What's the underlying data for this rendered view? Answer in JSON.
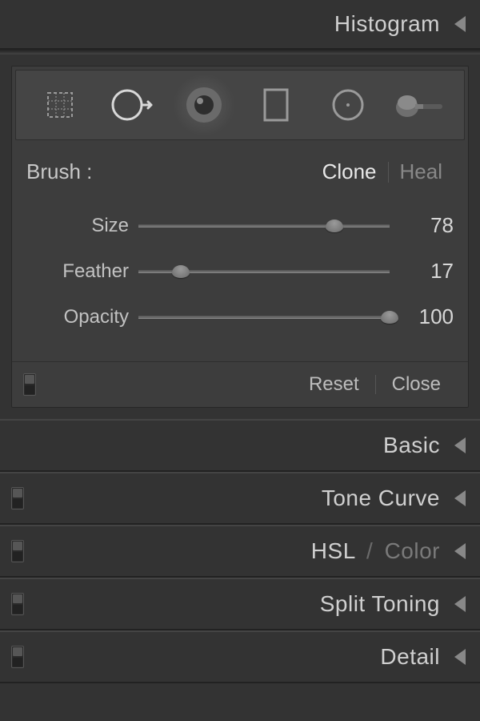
{
  "histogram": {
    "title": "Histogram"
  },
  "tools": [
    {
      "name": "crop-tool"
    },
    {
      "name": "spot-removal-tool",
      "selected": false
    },
    {
      "name": "redeye-tool",
      "selected": true
    },
    {
      "name": "graduated-filter-tool"
    },
    {
      "name": "radial-filter-tool"
    },
    {
      "name": "adjustment-brush-tool"
    }
  ],
  "brush": {
    "label": "Brush :",
    "modes": {
      "clone": "Clone",
      "heal": "Heal",
      "active": "clone"
    },
    "sliders": {
      "size": {
        "label": "Size",
        "value": 78,
        "max": 100
      },
      "feather": {
        "label": "Feather",
        "value": 17,
        "max": 100
      },
      "opacity": {
        "label": "Opacity",
        "value": 100,
        "max": 100
      }
    },
    "footer": {
      "reset": "Reset",
      "close": "Close"
    }
  },
  "panels": {
    "basic": {
      "label": "Basic"
    },
    "tone_curve": {
      "label": "Tone Curve"
    },
    "hsl": {
      "label1": "HSL",
      "sep": "/",
      "label2": "Color"
    },
    "split_toning": {
      "label": "Split Toning"
    },
    "detail": {
      "label": "Detail"
    }
  }
}
